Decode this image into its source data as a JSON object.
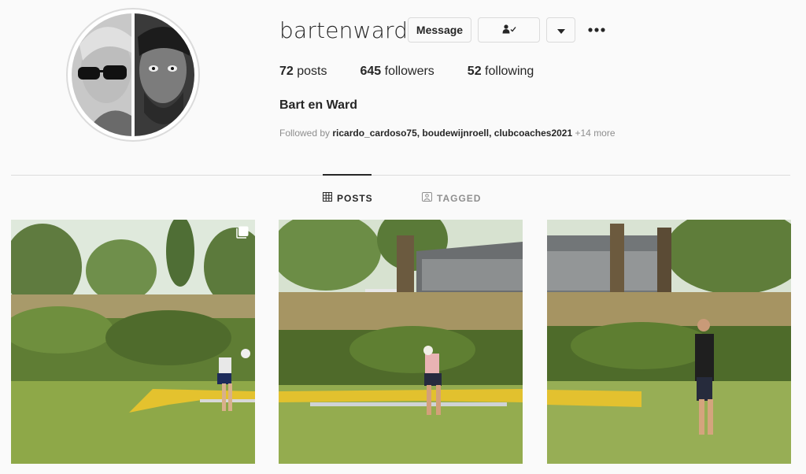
{
  "profile": {
    "username": "bartenward",
    "full_name": "Bart en Ward",
    "message_label": "Message"
  },
  "stats": {
    "posts_count": "72",
    "posts_label": "posts",
    "followers_count": "645",
    "followers_label": "followers",
    "following_count": "52",
    "following_label": "following"
  },
  "followed_by": {
    "prefix": "Followed by",
    "names": "ricardo_cardoso75, boudewijnroell, clubcoaches2021",
    "more": "+14 more"
  },
  "tabs": [
    {
      "label": "POSTS",
      "icon": "grid-icon",
      "active": true
    },
    {
      "label": "TAGGED",
      "icon": "tagged-icon",
      "active": false
    }
  ],
  "icons": {
    "follow_status": "person-check-icon",
    "dropdown": "caret-down-icon",
    "more": "more-dots-icon",
    "multi_post": "multiple-posts-icon"
  },
  "colors": {
    "text": "#262626",
    "secondary_text": "#8e8e8e",
    "border": "#dbdbdb",
    "background": "#fafafa"
  },
  "posts": [
    {
      "subject": "person in striped tri-suit bending over yellow kayak-shaped boat on grass",
      "multiple": true
    },
    {
      "subject": "person assembling yellow boat on grass in front of stadium",
      "multiple": false
    },
    {
      "subject": "person walking beside yellow boat on grass near stadium",
      "multiple": false
    }
  ]
}
